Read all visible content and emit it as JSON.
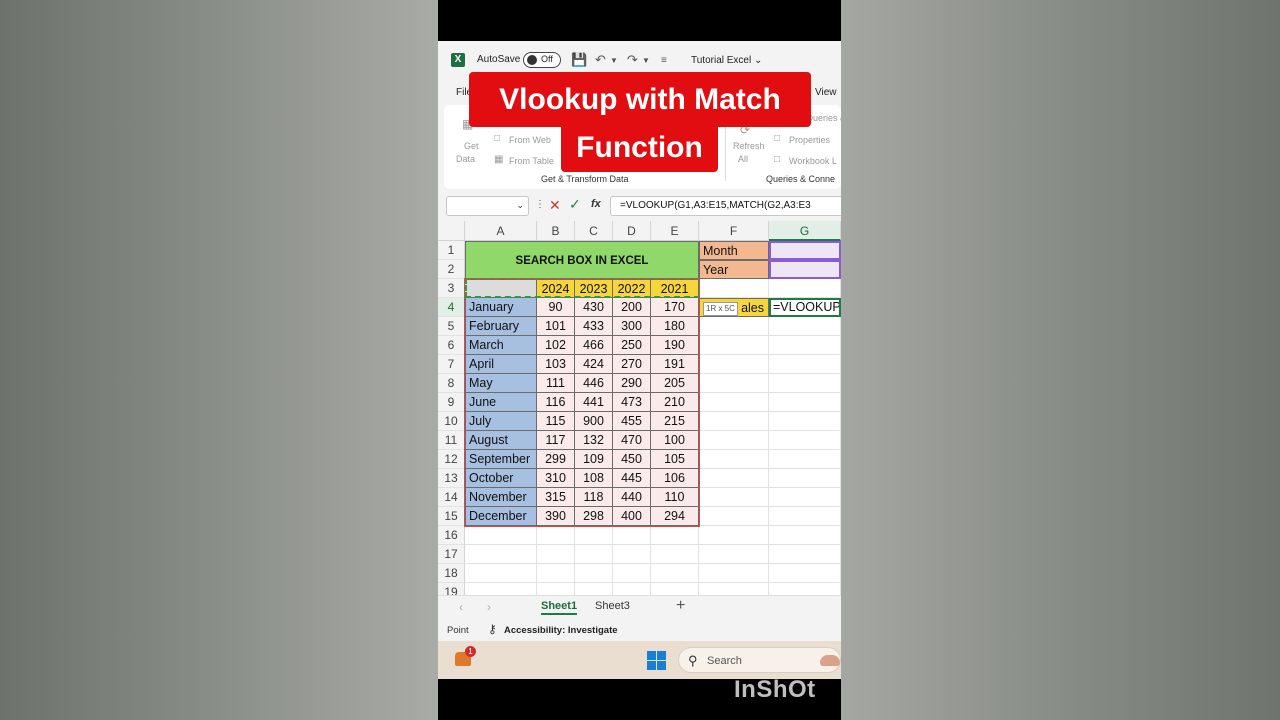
{
  "window": {
    "autosave_label": "AutoSave",
    "autosave_state": "Off",
    "doc_title": "Tutorial Excel"
  },
  "ribbon": {
    "tab_file": "File",
    "tab_view": "View",
    "get_data_1": "Get",
    "get_data_2": "Data",
    "from_web": "From Web",
    "from_table": "From Table",
    "group_transform": "Get & Transform Data",
    "queries": "Queries & C",
    "refresh_1": "Refresh",
    "refresh_2": "All",
    "properties": "Properties",
    "workbook": "Workbook L",
    "group_queries": "Queries & Conne"
  },
  "formula_bar": {
    "name_box": "",
    "formula": "=VLOOKUP(G1,A3:E15,MATCH(G2,A3:E3"
  },
  "grid": {
    "columns": [
      "A",
      "B",
      "C",
      "D",
      "E",
      "F",
      "G"
    ],
    "rows": [
      "1",
      "2",
      "3",
      "4",
      "5",
      "6",
      "7",
      "8",
      "9",
      "10",
      "11",
      "12",
      "13",
      "14",
      "15",
      "16",
      "17",
      "18",
      "19"
    ],
    "title": "SEARCH BOX IN EXCEL",
    "years": [
      "2024",
      "2023",
      "2022",
      "2021"
    ],
    "table": [
      {
        "month": "January",
        "values": [
          "90",
          "430",
          "200",
          "170"
        ]
      },
      {
        "month": "February",
        "values": [
          "101",
          "433",
          "300",
          "180"
        ]
      },
      {
        "month": "March",
        "values": [
          "102",
          "466",
          "250",
          "190"
        ]
      },
      {
        "month": "April",
        "values": [
          "103",
          "424",
          "270",
          "191"
        ]
      },
      {
        "month": "May",
        "values": [
          "111",
          "446",
          "290",
          "205"
        ]
      },
      {
        "month": "June",
        "values": [
          "116",
          "441",
          "473",
          "210"
        ]
      },
      {
        "month": "July",
        "values": [
          "115",
          "900",
          "455",
          "215"
        ]
      },
      {
        "month": "August",
        "values": [
          "117",
          "132",
          "470",
          "100"
        ]
      },
      {
        "month": "September",
        "values": [
          "299",
          "109",
          "450",
          "105"
        ]
      },
      {
        "month": "October",
        "values": [
          "310",
          "108",
          "445",
          "106"
        ]
      },
      {
        "month": "November",
        "values": [
          "315",
          "118",
          "440",
          "110"
        ]
      },
      {
        "month": "December",
        "values": [
          "390",
          "298",
          "400",
          "294"
        ]
      }
    ],
    "label_month": "Month",
    "label_year": "Year",
    "label_sales": "ales",
    "active_cell_text": "=VLOOKUP(G",
    "size_tooltip": "1R x 5C"
  },
  "sheets": {
    "tabs": [
      "Sheet1",
      "Sheet3"
    ],
    "active": "Sheet1",
    "add_label": "+"
  },
  "status": {
    "mode": "Point",
    "accessibility": "Accessibility: Investigate"
  },
  "taskbar": {
    "badge_count": "1",
    "search_label": "Search"
  },
  "overlay": {
    "title_line1": "Vlookup with Match",
    "title_line2": "Function",
    "watermark": "InShOt"
  },
  "colors": {
    "excel_green": "#1e7b45",
    "title_fill": "#90d86a",
    "year_fill": "#f6d63a",
    "month_fill": "#a7bfe0",
    "value_fill": "#fbeaea",
    "label_fill": "#f3b88f",
    "banner_red": "#e10d10"
  }
}
